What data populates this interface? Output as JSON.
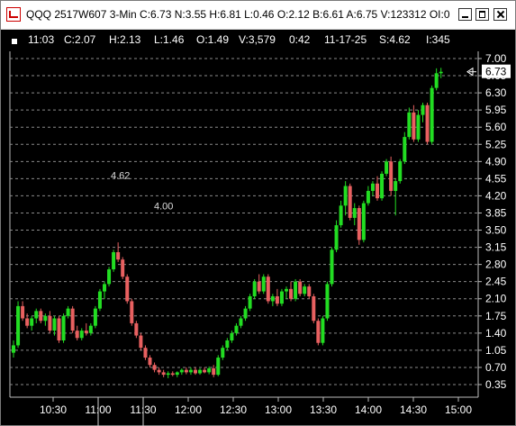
{
  "window": {
    "title": "QQQ 2517W607 3-Min C:6.73 N:3.55 H:6.81 L:0.46 O:2.12 B:6.61 A:6.75 V:123312 OI:0"
  },
  "info_bar": {
    "items": [
      "11:03",
      "C:2.07",
      "H:2.13",
      "L:1.46",
      "O:1.49",
      "V:3,579",
      "0:42",
      "11-17-25",
      "S:4.62",
      "I:345"
    ]
  },
  "colors": {
    "up": "#22dd22",
    "down": "#e86060",
    "grid": "#8a8a8a",
    "background": "#000000",
    "axis_text": "#ffffff"
  },
  "chart_data": {
    "type": "candlestick",
    "title": "",
    "ylim": [
      0.35,
      7.0
    ],
    "y_ticks": [
      "7.00",
      "6.65",
      "6.30",
      "5.95",
      "5.60",
      "5.25",
      "4.90",
      "4.55",
      "4.20",
      "3.85",
      "3.50",
      "3.15",
      "2.80",
      "2.45",
      "2.10",
      "1.75",
      "1.40",
      "1.05",
      "0.70",
      "0.35"
    ],
    "x_ticks": [
      "10:30",
      "11:00",
      "11:30",
      "12:00",
      "12:30",
      "13:00",
      "13:30",
      "14:00",
      "14:30",
      "15:00"
    ],
    "last_price_label": "6.73",
    "annotations": [
      {
        "text": "4.62",
        "value": 4.62
      },
      {
        "text": "4.00",
        "value": 4.0
      }
    ],
    "candles": [
      [
        1.0,
        1.25,
        0.9,
        1.15
      ],
      [
        1.15,
        2.05,
        1.1,
        1.95
      ],
      [
        1.95,
        2.05,
        1.65,
        1.7
      ],
      [
        1.7,
        1.8,
        1.5,
        1.55
      ],
      [
        1.55,
        1.75,
        1.45,
        1.7
      ],
      [
        1.7,
        1.9,
        1.6,
        1.85
      ],
      [
        1.85,
        1.9,
        1.6,
        1.65
      ],
      [
        1.65,
        1.8,
        1.55,
        1.75
      ],
      [
        1.75,
        1.85,
        1.4,
        1.45
      ],
      [
        1.45,
        1.75,
        1.35,
        1.7
      ],
      [
        1.7,
        1.75,
        1.2,
        1.25
      ],
      [
        1.25,
        1.8,
        1.2,
        1.75
      ],
      [
        1.75,
        1.95,
        1.7,
        1.9
      ],
      [
        1.9,
        1.95,
        1.4,
        1.45
      ],
      [
        1.45,
        1.55,
        1.25,
        1.3
      ],
      [
        1.3,
        1.5,
        1.25,
        1.45
      ],
      [
        1.45,
        1.6,
        1.35,
        1.4
      ],
      [
        1.4,
        1.6,
        1.35,
        1.55
      ],
      [
        1.55,
        1.95,
        1.5,
        1.9
      ],
      [
        1.9,
        2.3,
        1.85,
        2.25
      ],
      [
        2.25,
        2.45,
        2.1,
        2.4
      ],
      [
        2.4,
        2.75,
        2.35,
        2.7
      ],
      [
        2.7,
        3.1,
        2.65,
        3.05
      ],
      [
        3.05,
        3.25,
        2.85,
        2.9
      ],
      [
        2.9,
        2.95,
        2.5,
        2.55
      ],
      [
        2.55,
        2.6,
        2.0,
        2.05
      ],
      [
        2.05,
        2.1,
        1.55,
        1.6
      ],
      [
        1.6,
        1.65,
        1.3,
        1.35
      ],
      [
        1.35,
        1.4,
        1.05,
        1.1
      ],
      [
        1.1,
        1.15,
        0.85,
        0.9
      ],
      [
        0.9,
        0.95,
        0.7,
        0.75
      ],
      [
        0.75,
        0.8,
        0.6,
        0.65
      ],
      [
        0.65,
        0.7,
        0.55,
        0.6
      ],
      [
        0.6,
        0.65,
        0.5,
        0.55
      ],
      [
        0.55,
        0.62,
        0.48,
        0.58
      ],
      [
        0.58,
        0.62,
        0.52,
        0.55
      ],
      [
        0.55,
        0.62,
        0.5,
        0.6
      ],
      [
        0.6,
        0.68,
        0.55,
        0.65
      ],
      [
        0.65,
        0.7,
        0.56,
        0.6
      ],
      [
        0.6,
        0.7,
        0.55,
        0.65
      ],
      [
        0.65,
        0.7,
        0.55,
        0.58
      ],
      [
        0.58,
        0.68,
        0.55,
        0.65
      ],
      [
        0.65,
        0.7,
        0.58,
        0.6
      ],
      [
        0.6,
        0.72,
        0.56,
        0.68
      ],
      [
        0.68,
        0.75,
        0.5,
        0.55
      ],
      [
        0.55,
        0.95,
        0.52,
        0.9
      ],
      [
        0.9,
        1.15,
        0.85,
        1.1
      ],
      [
        1.1,
        1.3,
        1.05,
        1.25
      ],
      [
        1.25,
        1.45,
        1.2,
        1.4
      ],
      [
        1.4,
        1.6,
        1.35,
        1.55
      ],
      [
        1.55,
        1.75,
        1.5,
        1.7
      ],
      [
        1.7,
        1.95,
        1.65,
        1.9
      ],
      [
        1.9,
        2.2,
        1.85,
        2.15
      ],
      [
        2.15,
        2.5,
        2.1,
        2.45
      ],
      [
        2.45,
        2.6,
        2.2,
        2.25
      ],
      [
        2.25,
        2.6,
        2.2,
        2.55
      ],
      [
        2.55,
        2.6,
        2.0,
        2.05
      ],
      [
        2.05,
        2.2,
        1.95,
        2.15
      ],
      [
        2.15,
        2.3,
        1.95,
        2.0
      ],
      [
        2.0,
        2.3,
        1.95,
        2.25
      ],
      [
        2.25,
        2.35,
        2.1,
        2.3
      ],
      [
        2.3,
        2.45,
        2.05,
        2.1
      ],
      [
        2.1,
        2.5,
        2.05,
        2.45
      ],
      [
        2.45,
        2.5,
        2.15,
        2.2
      ],
      [
        2.2,
        2.4,
        2.15,
        2.35
      ],
      [
        2.35,
        2.4,
        2.1,
        2.15
      ],
      [
        2.15,
        2.2,
        1.6,
        1.65
      ],
      [
        1.65,
        1.7,
        1.15,
        1.2
      ],
      [
        1.2,
        1.75,
        1.15,
        1.7
      ],
      [
        1.7,
        2.45,
        1.65,
        2.4
      ],
      [
        2.4,
        3.15,
        2.35,
        3.1
      ],
      [
        3.1,
        3.7,
        3.05,
        3.6
      ],
      [
        3.6,
        4.1,
        3.55,
        4.0
      ],
      [
        4.0,
        4.5,
        3.8,
        4.4
      ],
      [
        4.4,
        4.45,
        3.7,
        3.75
      ],
      [
        3.75,
        4.05,
        3.6,
        3.95
      ],
      [
        3.95,
        4.0,
        3.2,
        3.3
      ],
      [
        3.3,
        4.1,
        3.25,
        4.05
      ],
      [
        4.05,
        4.4,
        4.0,
        4.3
      ],
      [
        4.3,
        4.5,
        4.2,
        4.45
      ],
      [
        4.45,
        4.6,
        4.1,
        4.15
      ],
      [
        4.15,
        4.7,
        4.1,
        4.65
      ],
      [
        4.65,
        4.95,
        4.6,
        4.9
      ],
      [
        4.9,
        5.0,
        4.2,
        4.3
      ],
      [
        4.3,
        4.55,
        3.8,
        4.5
      ],
      [
        4.5,
        4.95,
        4.45,
        4.9
      ],
      [
        4.9,
        5.5,
        4.85,
        5.4
      ],
      [
        5.4,
        6.0,
        5.35,
        5.9
      ],
      [
        5.9,
        6.05,
        5.3,
        5.35
      ],
      [
        5.35,
        5.95,
        5.3,
        5.85
      ],
      [
        5.85,
        6.1,
        5.7,
        6.05
      ],
      [
        6.05,
        6.1,
        5.25,
        5.3
      ],
      [
        5.3,
        6.45,
        5.25,
        6.4
      ],
      [
        6.4,
        6.8,
        6.35,
        6.7
      ],
      [
        6.7,
        6.81,
        6.6,
        6.73
      ]
    ]
  }
}
